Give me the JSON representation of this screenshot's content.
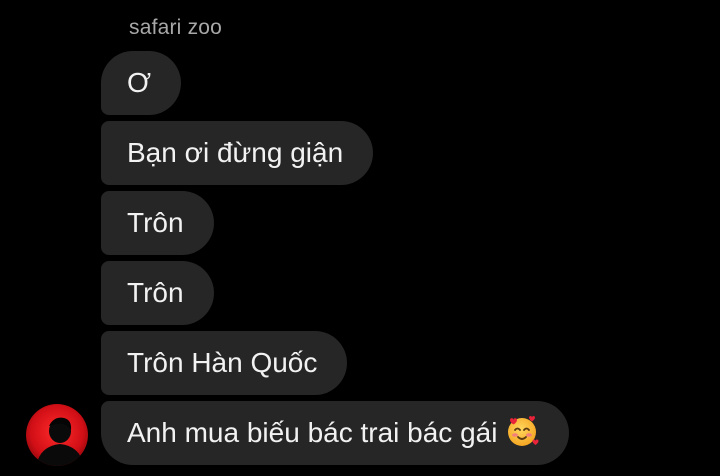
{
  "sender": {
    "name": "safari zoo"
  },
  "messages": [
    {
      "text": "Ơ"
    },
    {
      "text": "Bạn ơi đừng giận"
    },
    {
      "text": "Trôn"
    },
    {
      "text": "Trôn"
    },
    {
      "text": "Trôn Hàn Quốc"
    },
    {
      "text": "Anh mua biếu bác trai bác gái",
      "emoji": "smiling-face-with-hearts-icon"
    }
  ],
  "colors": {
    "background": "#000000",
    "bubble": "#262626",
    "message_text": "#f2f2f2",
    "sender_name": "#a8a8a8",
    "avatar_accent": "#e0121a"
  }
}
